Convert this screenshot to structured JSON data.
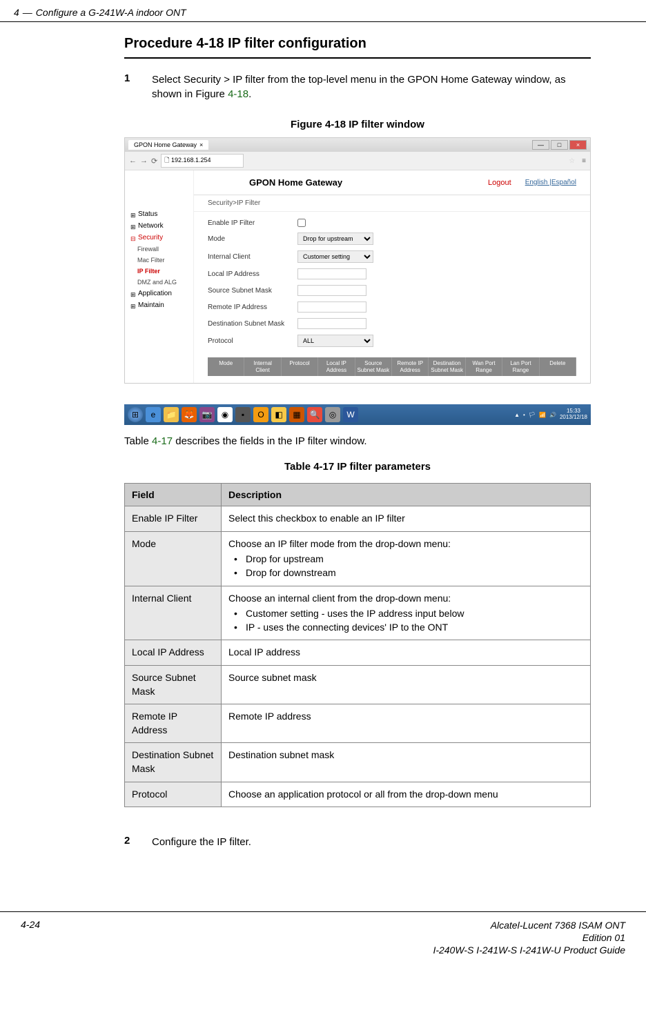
{
  "header": {
    "chapter_num": "4",
    "dash": "—",
    "chapter_title": "Configure a G-241W-A indoor ONT"
  },
  "procedure": {
    "title": "Procedure 4-18  IP filter configuration"
  },
  "step1": {
    "num": "1",
    "text_pre": "Select Security > IP filter from the top-level menu in the GPON Home Gateway window, as shown in Figure ",
    "fig_ref": "4-18",
    "text_post": "."
  },
  "figure": {
    "caption": "Figure 4-18  IP filter window"
  },
  "browser": {
    "tab_title": "GPON Home Gateway",
    "tab_close": "×",
    "nav_back": "←",
    "nav_fwd": "→",
    "reload": "⟳",
    "url": "192.168.1.254",
    "star": "☆",
    "menu": "≡"
  },
  "gpon": {
    "title": "GPON Home Gateway",
    "logout": "Logout",
    "lang": "English |Español",
    "breadcrumb": "Security>IP Filter",
    "nav": {
      "status": "Status",
      "network": "Network",
      "security": "Security",
      "firewall": "Firewall",
      "mac_filter": "Mac Filter",
      "ip_filter": "IP Filter",
      "dmz_alg": "DMZ and ALG",
      "application": "Application",
      "maintain": "Maintain"
    },
    "form": {
      "enable_label": "Enable IP Filter",
      "mode_label": "Mode",
      "mode_value": "Drop for upstream",
      "internal_label": "Internal Client",
      "internal_value": "Customer setting",
      "local_ip_label": "Local IP Address",
      "source_mask_label": "Source Subnet Mask",
      "remote_ip_label": "Remote IP Address",
      "dest_mask_label": "Destination Subnet Mask",
      "protocol_label": "Protocol",
      "protocol_value": "ALL"
    },
    "table_headers": {
      "mode": "Mode",
      "internal": "Internal Client",
      "protocol": "Protocol",
      "local_ip": "Local IP Address",
      "source_mask": "Source Subnet Mask",
      "remote_ip": "Remote IP Address",
      "dest_mask": "Destination Subnet Mask",
      "wan_port": "Wan Port Range",
      "lan_port": "Lan Port Range",
      "delete": "Delete"
    }
  },
  "taskbar": {
    "time": "15:33",
    "date": "2013/12/18"
  },
  "table_desc": {
    "pre": "Table ",
    "ref": "4-17",
    "post": " describes the fields in the IP filter window."
  },
  "table": {
    "caption": "Table 4-17 IP filter parameters",
    "th_field": "Field",
    "th_desc": "Description",
    "rows": [
      {
        "field": "Enable IP Filter",
        "desc": "Select this checkbox to enable an IP filter"
      },
      {
        "field": "Mode",
        "desc": "Choose an IP filter mode from the drop-down menu:",
        "bullets": [
          "Drop for upstream",
          "Drop for downstream"
        ]
      },
      {
        "field": "Internal Client",
        "desc": "Choose an internal client from the drop-down menu:",
        "bullets": [
          "Customer setting - uses the IP address input below",
          "IP - uses the connecting devices' IP to the ONT"
        ]
      },
      {
        "field": "Local IP Address",
        "desc": "Local IP address"
      },
      {
        "field": "Source Subnet Mask",
        "desc": "Source subnet mask"
      },
      {
        "field": "Remote IP Address",
        "desc": "Remote IP address"
      },
      {
        "field": "Destination Subnet Mask",
        "desc": "Destination subnet mask"
      },
      {
        "field": "Protocol",
        "desc": "Choose an application protocol or all from the drop-down menu"
      }
    ]
  },
  "step2": {
    "num": "2",
    "text": "Configure the IP filter."
  },
  "footer": {
    "page": "4-24",
    "line1": "Alcatel-Lucent 7368 ISAM ONT",
    "line2": "Edition 01",
    "line3": "I-240W-S I-241W-S I-241W-U Product Guide"
  }
}
